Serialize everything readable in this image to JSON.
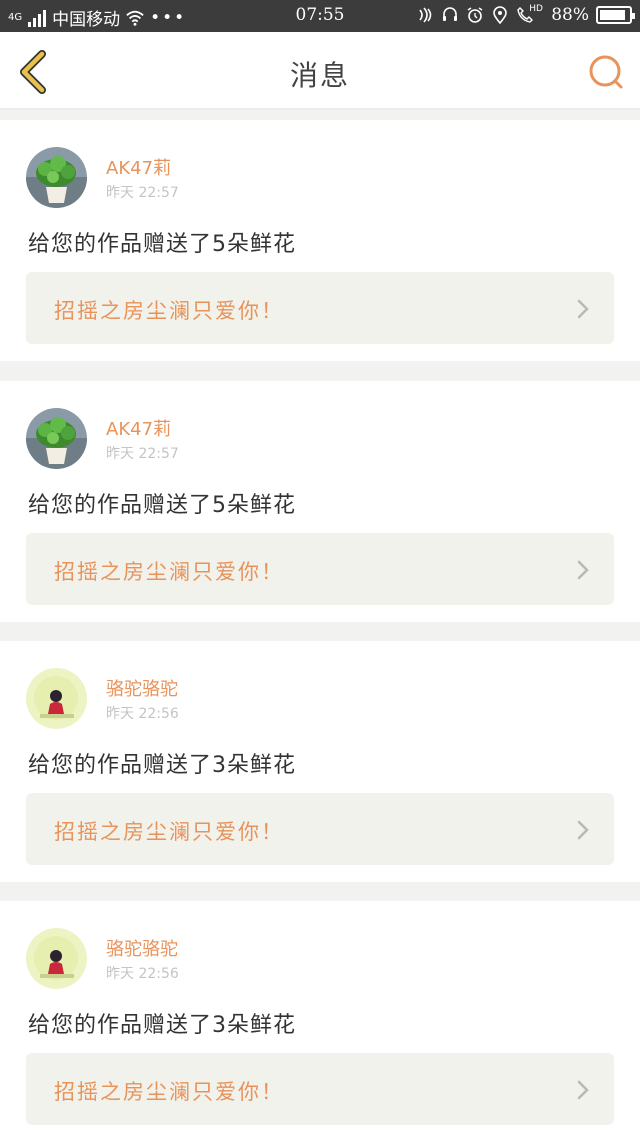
{
  "status": {
    "network": "4G",
    "carrier": "中国移动",
    "time": "07:55",
    "hd": "HD",
    "battery": "88%",
    "battery_level": 0.88
  },
  "header": {
    "title": "消息"
  },
  "messages": [
    {
      "user": "AK47莉",
      "time": "昨天 22:57",
      "text": "给您的作品赠送了5朵鲜花",
      "reply": "招摇之房尘澜只爱你！"
    },
    {
      "user": "AK47莉",
      "time": "昨天 22:57",
      "text": "给您的作品赠送了5朵鲜花",
      "reply": "招摇之房尘澜只爱你！"
    },
    {
      "user": "骆驼骆驼",
      "time": "昨天 22:56",
      "text": "给您的作品赠送了3朵鲜花",
      "reply": "招摇之房尘澜只爱你！"
    },
    {
      "user": "骆驼骆驼",
      "time": "昨天 22:56",
      "text": "给您的作品赠送了3朵鲜花",
      "reply": "招摇之房尘澜只爱你！"
    }
  ],
  "colors": {
    "accent": "#e8935a",
    "back_icon": "#e8c24a",
    "reply_bg": "#f2f2ec"
  }
}
